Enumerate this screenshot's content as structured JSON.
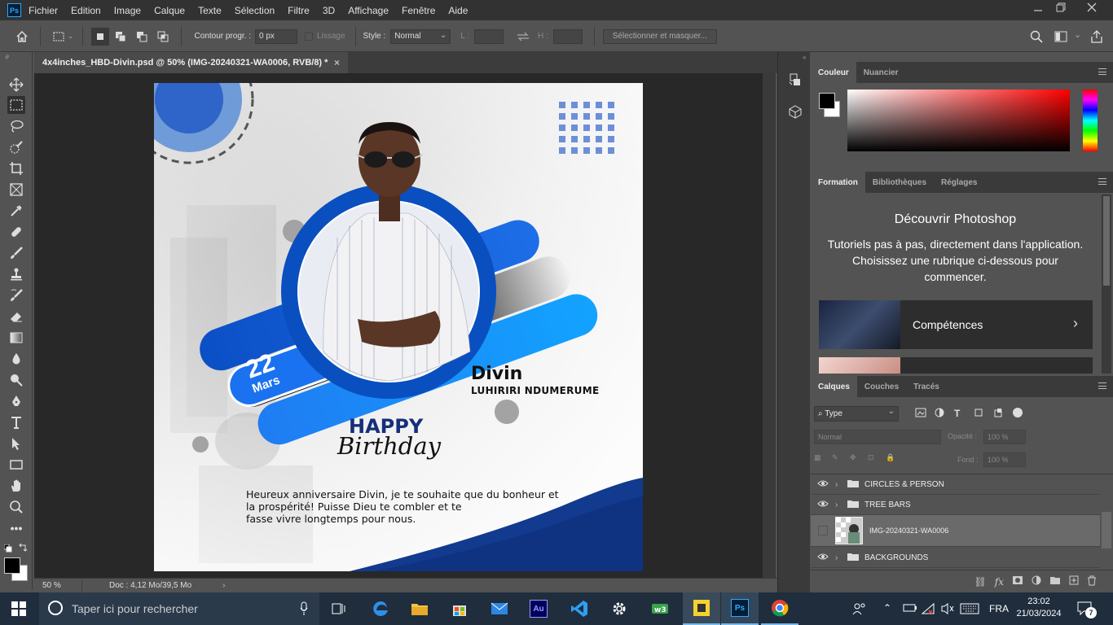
{
  "menubar": {
    "logo": "Ps",
    "items": [
      "Fichier",
      "Edition",
      "Image",
      "Calque",
      "Texte",
      "Sélection",
      "Filtre",
      "3D",
      "Affichage",
      "Fenêtre",
      "Aide"
    ]
  },
  "options": {
    "contour_label": "Contour progr. :",
    "contour_value": "0 px",
    "lissage": "Lissage",
    "style_label": "Style :",
    "style_value": "Normal",
    "l_label": "L :",
    "h_label": "H :",
    "select_mask": "Sélectionner et masquer..."
  },
  "document": {
    "tab_title": "4x4inches_HBD-Divin.psd @ 50% (IMG-20240321-WA0006, RVB/8) *",
    "close": "×"
  },
  "artwork": {
    "day": "22",
    "month": "Mars",
    "first_name": "Divin",
    "last_name": "LUHIRIRI NDUMERUME",
    "happy": "HAPPY",
    "birthday": "Birthday",
    "message": [
      "Heureux anniversaire Divin, je te souhaite que du bonheur et",
      "la prospérité! Puisse Dieu te combler et te",
      "fasse vivre longtemps pour nous."
    ]
  },
  "status": {
    "zoom": "50 %",
    "doc": "Doc : 4,12 Mo/39,5 Mo"
  },
  "color_panel": {
    "tabs": [
      "Couleur",
      "Nuancier"
    ]
  },
  "learn_panel": {
    "tabs": [
      "Formation",
      "Bibliothèques",
      "Réglages"
    ],
    "title": "Découvrir Photoshop",
    "body": "Tutoriels pas à pas, directement dans l'application. Choisissez une rubrique ci-dessous pour commencer.",
    "card_label": "Compétences"
  },
  "layers_panel": {
    "tabs": [
      "Calques",
      "Couches",
      "Tracés"
    ],
    "filter": "Type",
    "blend": "Normal",
    "opacity_label": "Opacité :",
    "opacity_value": "100 %",
    "fill_label": "Fond :",
    "fill_value": "100 %",
    "layers": [
      {
        "name": "CIRCLES & PERSON",
        "kind": "group",
        "visible": true
      },
      {
        "name": "TREE BARS",
        "kind": "group",
        "visible": true
      },
      {
        "name": "IMG-20240321-WA0006",
        "kind": "image",
        "visible": false,
        "selected": true
      },
      {
        "name": "BACKGROUNDS",
        "kind": "group",
        "visible": true
      }
    ]
  },
  "taskbar": {
    "search_placeholder": "Taper ici pour rechercher",
    "lang": "FRA",
    "time": "23:02",
    "date": "21/03/2024",
    "notif_count": "7"
  },
  "colors": {
    "accent_blue": "#0a4fbf",
    "bright_blue": "#1f86ff",
    "navy": "#123a8f",
    "ps_blue": "#31a8ff"
  }
}
